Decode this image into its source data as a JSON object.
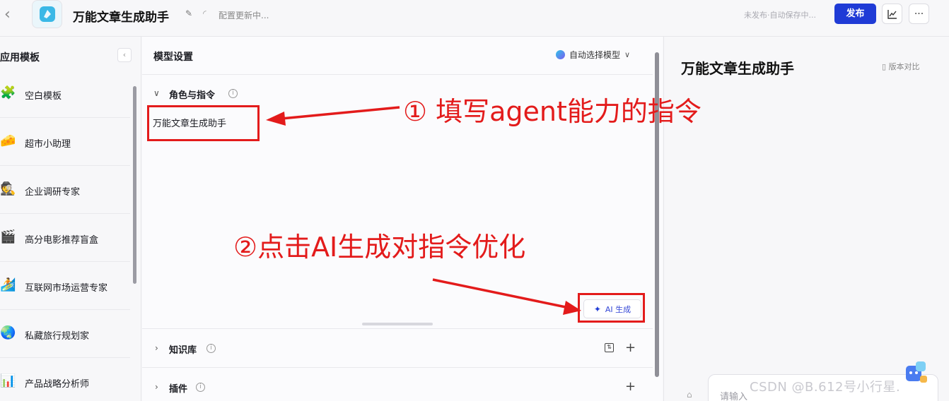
{
  "header": {
    "app_title": "万能文章生成助手",
    "status": "配置更新中...",
    "save_status": "未发布·自动保存中...",
    "publish_label": "发布",
    "icons": [
      "back-chevron-icon",
      "app-logo",
      "edit-icon",
      "loading-icon",
      "chart-icon",
      "more-icon"
    ]
  },
  "sidebar": {
    "title": "应用模板",
    "collapse_glyph": "‹",
    "items": [
      {
        "label": "空白模板",
        "icon": "🧩"
      },
      {
        "label": "超市小助理",
        "icon": "🧀"
      },
      {
        "label": "企业调研专家",
        "icon": "🕵"
      },
      {
        "label": "高分电影推荐盲盒",
        "icon": "🎬"
      },
      {
        "label": "互联网市场运营专家",
        "icon": "🏄"
      },
      {
        "label": "私藏旅行规划家",
        "icon": "🌏"
      },
      {
        "label": "产品战略分析师",
        "icon": "📊"
      }
    ]
  },
  "main": {
    "title": "模型设置",
    "model_select": "自动选择模型",
    "sections": {
      "role": {
        "title": "角色与指令",
        "prompt": "万能文章生成助手"
      },
      "knowledge": {
        "title": "知识库"
      },
      "plugins": {
        "title": "插件"
      }
    },
    "ai_generate_label": "AI 生成"
  },
  "preview": {
    "title": "万能文章生成助手",
    "compare_label": "版本对比",
    "input_placeholder": "请输入"
  },
  "annotations": {
    "step1": "① 填写agent能力的指令",
    "step2": "②点击AI生成对指令优化",
    "color": "#e31b1b"
  },
  "watermark": "CSDN @B.612号小行星."
}
